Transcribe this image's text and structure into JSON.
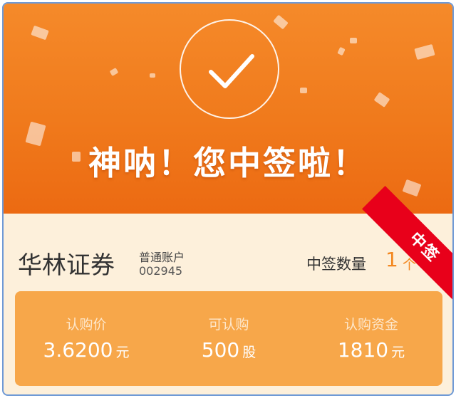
{
  "hero": {
    "headline": "神呐！您中签啦！",
    "check_icon": "check-circle-icon"
  },
  "ribbon": {
    "label": "中签"
  },
  "account": {
    "broker": "华林证券",
    "type": "普通账户",
    "code": "002945"
  },
  "win": {
    "label": "中签数量",
    "count": "1",
    "unit": "个"
  },
  "subscription": [
    {
      "label": "认购价",
      "value": "3.6200",
      "unit": "元"
    },
    {
      "label": "可认购",
      "value": "500",
      "unit": "股"
    },
    {
      "label": "认购资金",
      "value": "1810",
      "unit": "元"
    }
  ],
  "colors": {
    "hero_top": "#f58a2a",
    "hero_bottom": "#ec6a12",
    "panel_bg": "#fdf0db",
    "card_bg": "#f7a74a",
    "accent": "#f3871f",
    "ribbon": "#e8001a"
  }
}
